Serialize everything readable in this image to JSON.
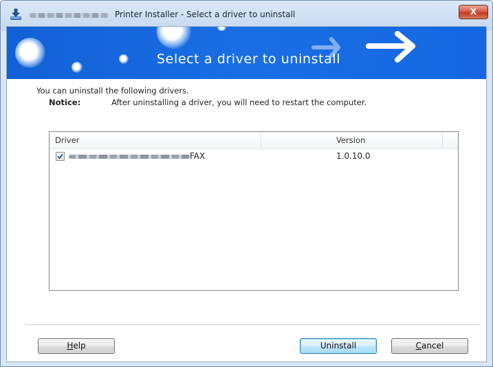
{
  "window": {
    "title": "Printer Installer - Select a driver to uninstall",
    "close_label": "X"
  },
  "banner": {
    "title": "Select a driver to uninstall"
  },
  "content": {
    "intro": "You can uninstall the following drivers.",
    "notice_label": "Notice:",
    "notice_text": "After uninstalling a driver, you will need to restart the computer."
  },
  "list": {
    "columns": [
      "Driver",
      "Version"
    ],
    "rows": [
      {
        "checked": true,
        "name_suffix": "FAX",
        "version": "1.0.10.0"
      }
    ]
  },
  "buttons": {
    "help": {
      "mnemonic": "H",
      "rest": "elp"
    },
    "uninstall": {
      "label": "Uninstall"
    },
    "cancel": {
      "mnemonic": "C",
      "rest": "ancel"
    }
  },
  "colors": {
    "banner": "#1565de",
    "accent": "#3c7fb1"
  },
  "icons": {
    "app": "download-arrow-icon",
    "close": "close-icon",
    "checkbox": "checkmark-icon"
  }
}
